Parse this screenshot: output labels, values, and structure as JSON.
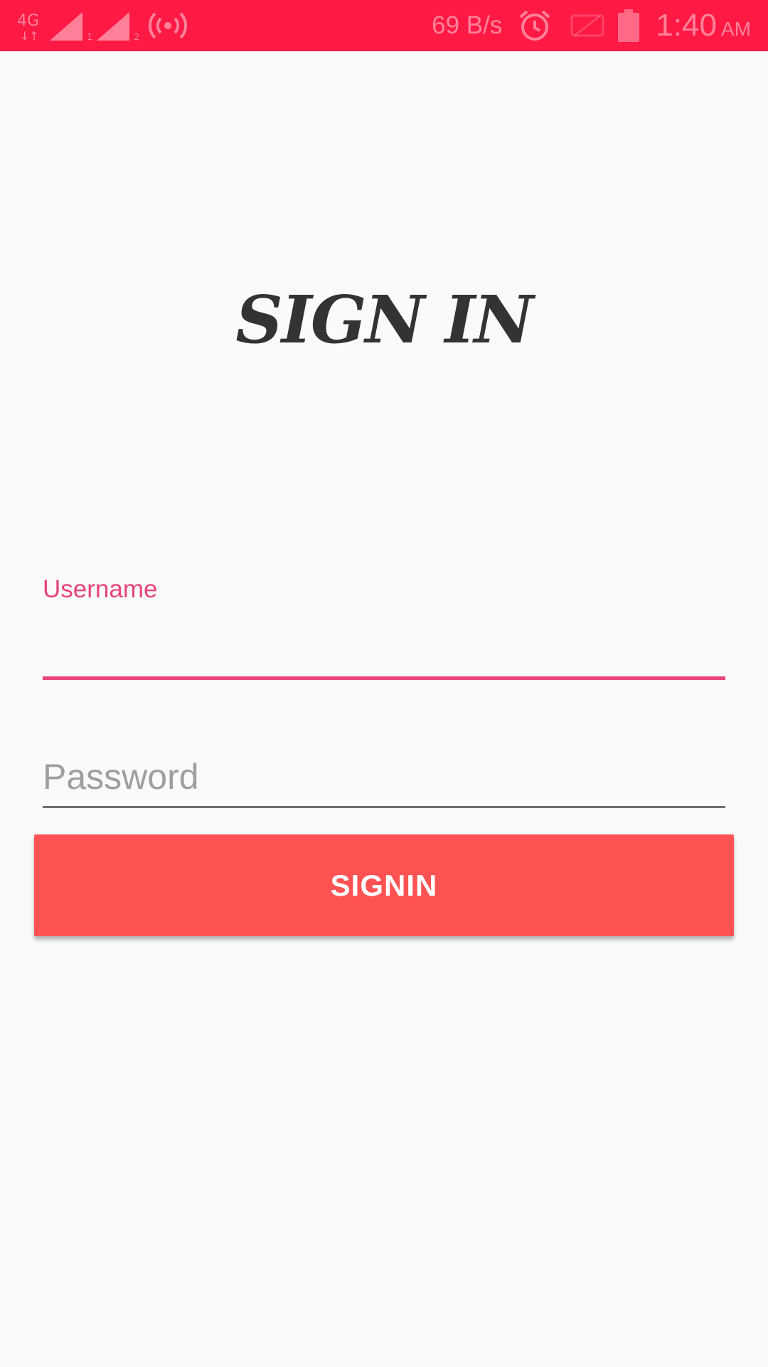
{
  "status_bar": {
    "network_type": "4G",
    "sim1_label": "1",
    "sim2_label": "2",
    "net_speed": "69 B/s",
    "time": "1:40",
    "ampm": "AM",
    "icons": [
      "network-4g-icon",
      "signal-sim1-icon",
      "signal-sim2-icon",
      "hotspot-icon",
      "alarm-icon",
      "sim-muted-icon",
      "battery-icon"
    ],
    "background_color": "#ff1a45"
  },
  "screen": {
    "title": "SIGN IN"
  },
  "form": {
    "username_label": "Username",
    "username_value": "",
    "password_placeholder": "Password",
    "password_value": "",
    "accent_color": "#e8457b"
  },
  "signin_button": {
    "label": "SIGNIN",
    "color": "#ff5252"
  }
}
